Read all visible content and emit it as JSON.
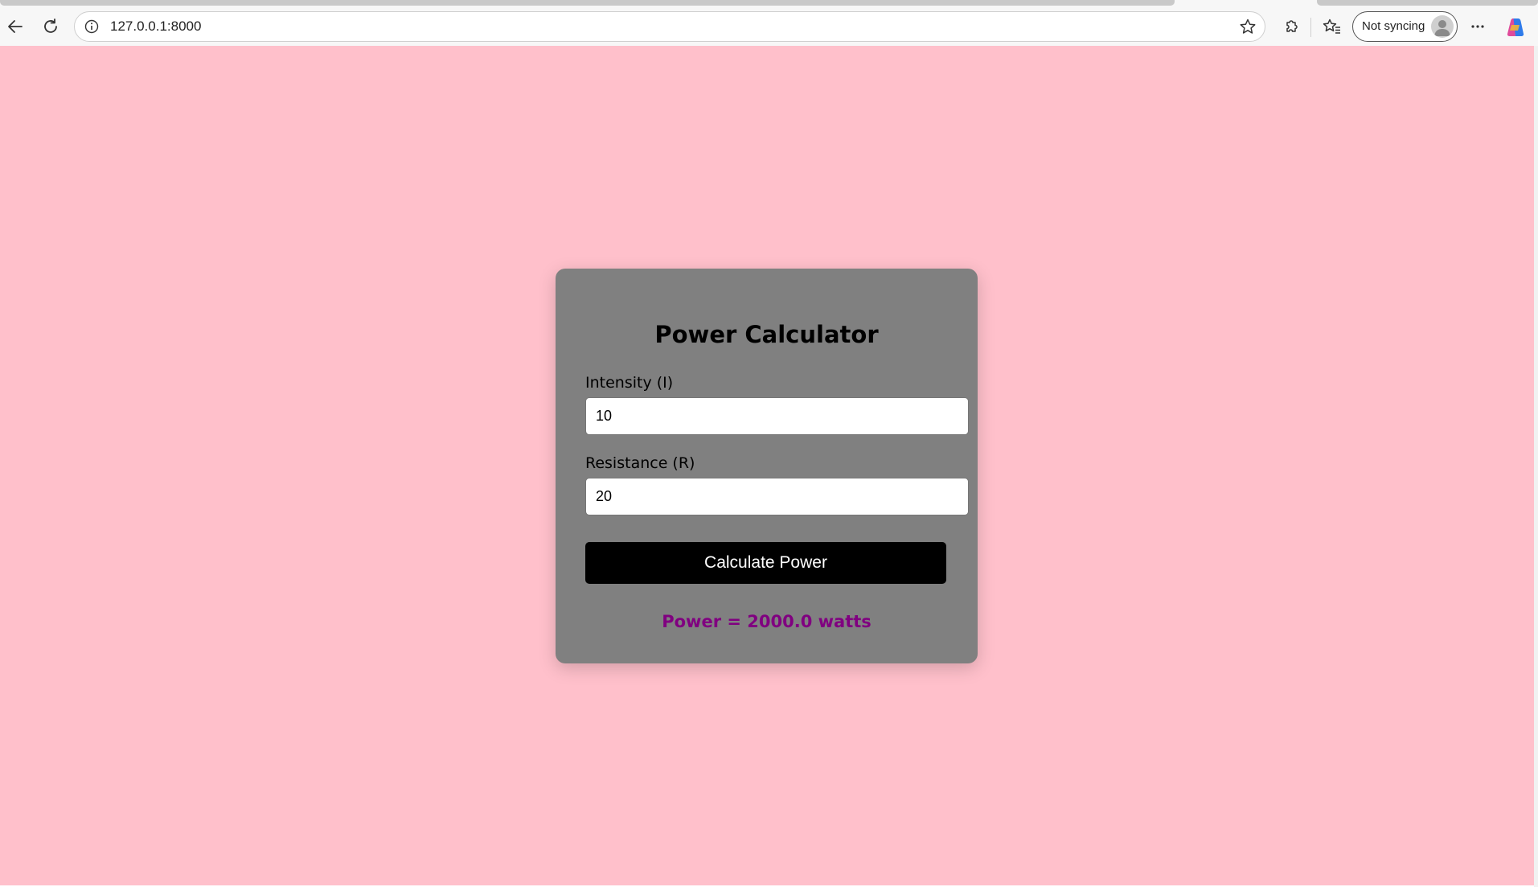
{
  "browser": {
    "url": "127.0.0.1:8000",
    "sync_label": "Not syncing",
    "icons": {
      "back": "back-arrow-icon",
      "reload": "reload-icon",
      "site_info": "info-icon",
      "favorite": "star-icon",
      "extensions": "puzzle-icon",
      "favorites": "favorites-icon",
      "profile": "avatar-icon",
      "more": "more-icon",
      "copilot": "copilot-icon"
    }
  },
  "page": {
    "background_color": "#ffc0cb",
    "card_color": "#808080",
    "title": "Power Calculator",
    "fields": [
      {
        "label": "Intensity (I)",
        "value": "10"
      },
      {
        "label": "Resistance (R)",
        "value": "20"
      }
    ],
    "button_label": "Calculate Power",
    "result_text": "Power = 2000.0 watts",
    "result_color": "#800080"
  }
}
